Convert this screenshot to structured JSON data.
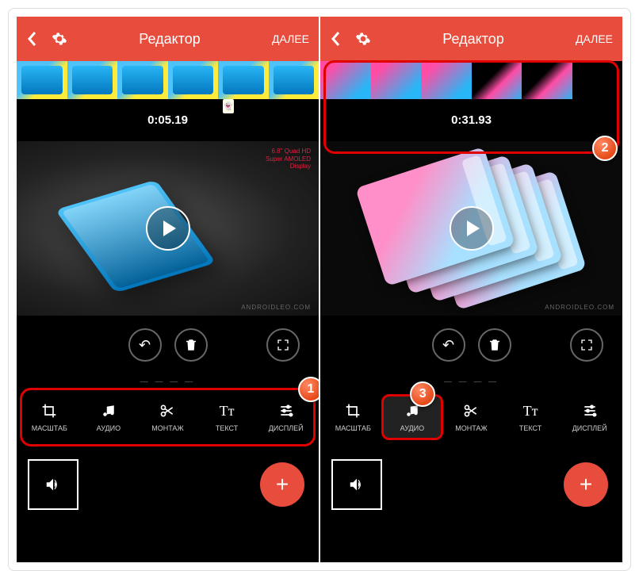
{
  "left": {
    "header": {
      "title": "Редактор",
      "next": "ДАЛЕЕ"
    },
    "time": "0:05.19",
    "watermark": "6.8\" Quad HD\nSuper AMOLED\nDisplay",
    "brand": "ANDROIDLEO.COM",
    "tools": [
      {
        "label": "МАСШТАБ",
        "icon": "crop"
      },
      {
        "label": "АУДИО",
        "icon": "music"
      },
      {
        "label": "МОНТАЖ",
        "icon": "cut"
      },
      {
        "label": "ТЕКСТ",
        "icon": "text"
      },
      {
        "label": "ДИСПЛЕЙ",
        "icon": "sliders"
      }
    ],
    "badge": "1"
  },
  "right": {
    "header": {
      "title": "Редактор",
      "next": "ДАЛЕЕ"
    },
    "time": "0:31.93",
    "brand": "ANDROIDLEO.COM",
    "tools": [
      {
        "label": "МАСШТАБ",
        "icon": "crop"
      },
      {
        "label": "АУДИО",
        "icon": "music"
      },
      {
        "label": "МОНТАЖ",
        "icon": "cut"
      },
      {
        "label": "ТЕКСТ",
        "icon": "text"
      },
      {
        "label": "ДИСПЛЕЙ",
        "icon": "sliders"
      }
    ],
    "badge_thumbs": "2",
    "badge_tool": "3"
  },
  "icons": {
    "undo": "↶",
    "trash": "🗑",
    "fullscreen": "⛶",
    "sound": "🔊",
    "plus": "+",
    "text_glyph": "Tᴛ"
  }
}
